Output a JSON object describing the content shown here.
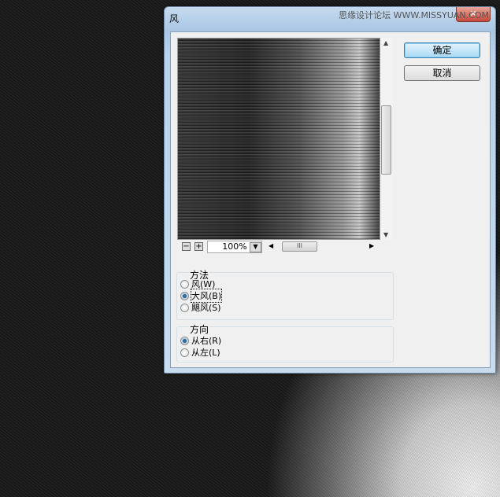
{
  "dialog": {
    "title": "风",
    "watermark": "思缘设计论坛 WWW.MISSYUAN.COM",
    "close_icon": "close-icon"
  },
  "buttons": {
    "ok": "确定",
    "cancel": "取消"
  },
  "preview": {
    "zoom": "100%",
    "zoom_out": "−",
    "zoom_in": "+",
    "thumb_grip": "III"
  },
  "method": {
    "label": "方法",
    "options": [
      "风(W)",
      "大风(B)",
      "飓风(S)"
    ],
    "selected": 1
  },
  "direction": {
    "label": "方向",
    "options": [
      "从右(R)",
      "从左(L)"
    ],
    "selected": 0
  }
}
